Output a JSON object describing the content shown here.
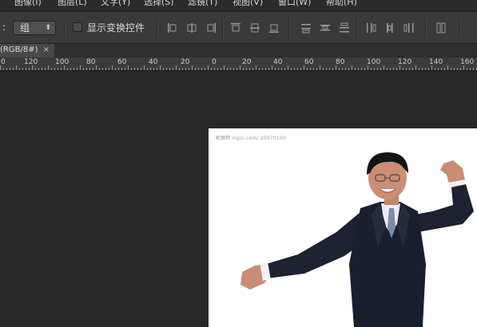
{
  "menubar": {
    "items": [
      "图像(I)",
      "图层(L)",
      "文字(Y)",
      "选择(S)",
      "滤镜(T)",
      "视图(V)",
      "窗口(W)",
      "帮助(H)"
    ]
  },
  "options": {
    "colon": ":",
    "select_value": "组",
    "checkbox_label": "显示变换控件"
  },
  "tab": {
    "label": "(RGB/8#)",
    "close": "×"
  },
  "ruler": {
    "labels": [
      "0",
      "120",
      "100",
      "80",
      "60",
      "40",
      "20",
      "0",
      "20",
      "40",
      "60",
      "80",
      "100",
      "120",
      "140",
      "160"
    ]
  },
  "document": {
    "watermark": "昵图网 nipic.com/ 20070100"
  }
}
